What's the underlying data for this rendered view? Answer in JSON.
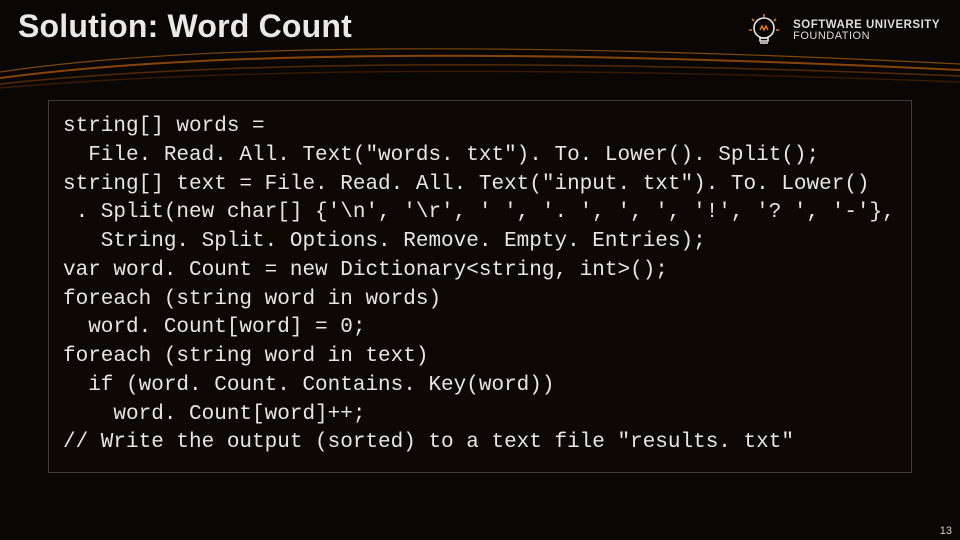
{
  "slide": {
    "title": "Solution: Word Count",
    "page_number": "13"
  },
  "logo": {
    "line1": "SOFTWARE UNIVERSITY",
    "line2": "FOUNDATION"
  },
  "code": {
    "line1": "string[] words =",
    "line2": "  File. Read. All. Text(\"words. txt\"). To. Lower(). Split();",
    "line3": "string[] text = File. Read. All. Text(\"input. txt\"). To. Lower()",
    "line4": " . Split(new char[] {'\\n', '\\r', ' ', '. ', ', ', '!', '? ', '-'},",
    "line5": "   String. Split. Options. Remove. Empty. Entries);",
    "line6": "var word. Count = new Dictionary<string, int>();",
    "line7": "foreach (string word in words)",
    "line8": "  word. Count[word] = 0;",
    "line9": "foreach (string word in text)",
    "line10": "  if (word. Count. Contains. Key(word))",
    "line11": "    word. Count[word]++;",
    "line12": "// Write the output (sorted) to a text file \"results. txt\""
  }
}
